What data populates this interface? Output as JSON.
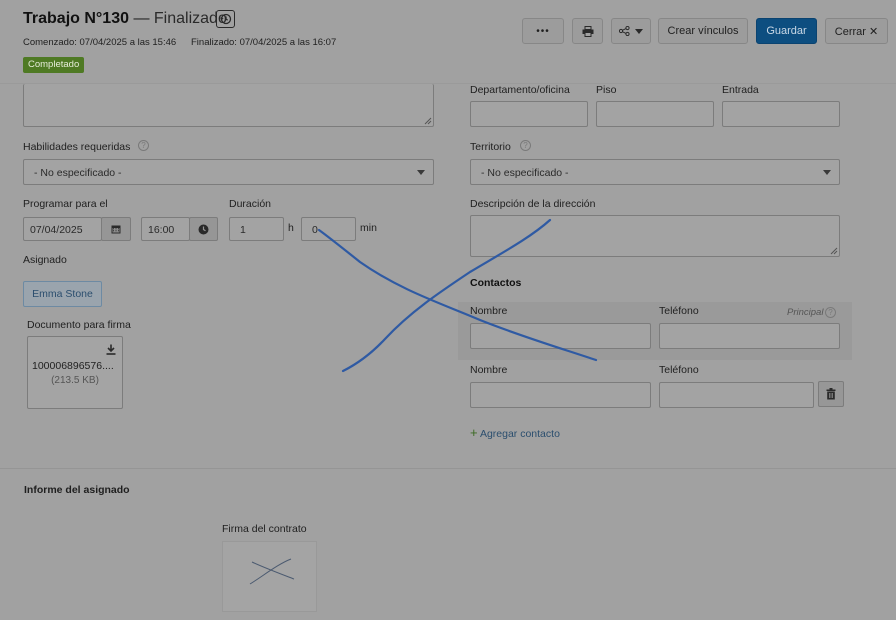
{
  "header": {
    "title": "Trabajo N°130",
    "separator": "—",
    "status": "Finalizado",
    "started": "Comenzado: 07/04/2025 a las 15:46",
    "finished": "Finalizado: 07/04/2025 a las 16:07",
    "badge": "Completado"
  },
  "toolbar": {
    "more_label": "•••",
    "links_label": "Crear vínculos",
    "save_label": "Guardar",
    "close_label": "Cerrar ✕"
  },
  "form": {
    "skills_label": "Habilidades requeridas",
    "skills_value": "- No especificado -",
    "schedule_label": "Programar para el",
    "date_value": "07/04/2025",
    "time_value": "16:00",
    "duration_label": "Duración",
    "hours_value": "1",
    "hours_unit": "h",
    "minutes_value": "0",
    "minutes_unit": "min",
    "assigned_label": "Asignado",
    "assignee": "Emma Stone",
    "document_label": "Documento para firma",
    "document_name": "100006896576....",
    "document_size": "(213.5 KB)",
    "dept_label": "Departamento/oficina",
    "floor_label": "Piso",
    "entrance_label": "Entrada",
    "territory_label": "Territorio",
    "territory_value": "- No especificado -",
    "address_desc_label": "Descripción de la dirección"
  },
  "contacts": {
    "heading": "Contactos",
    "name_label": "Nombre",
    "phone_label": "Teléfono",
    "primary_label": "Principal",
    "add_label": "Agregar contacto"
  },
  "report": {
    "heading": "Informe del asignado",
    "signature_label": "Firma del contrato"
  },
  "colors": {
    "accent": "#0d4e80",
    "badge": "#4f7a24",
    "overlay_stroke": "#2f5aa3"
  }
}
